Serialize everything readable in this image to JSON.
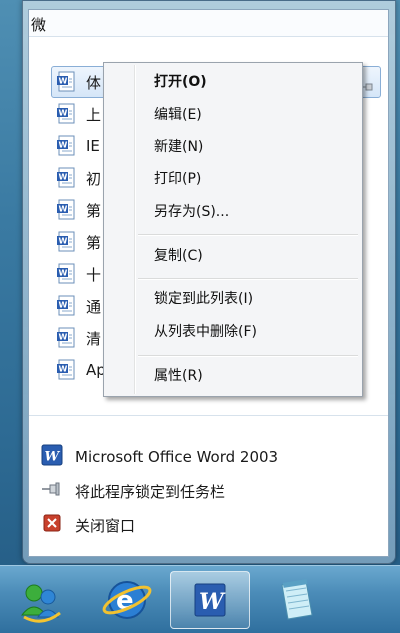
{
  "window": {
    "title_fragment": "微"
  },
  "recent_documents": [
    {
      "label": "体"
    },
    {
      "label": "上"
    },
    {
      "label": "IE"
    },
    {
      "label": "初"
    },
    {
      "label": "第"
    },
    {
      "label": "第"
    },
    {
      "label": "十"
    },
    {
      "label": "通"
    },
    {
      "label": "清"
    },
    {
      "label": "Ap"
    }
  ],
  "context_menu": {
    "open": "打开(O)",
    "edit": "编辑(E)",
    "new": "新建(N)",
    "print": "打印(P)",
    "save_as": "另存为(S)...",
    "copy": "复制(C)",
    "pin_to_list": "锁定到此列表(I)",
    "remove_from_list": "从列表中删除(F)",
    "properties": "属性(R)"
  },
  "tasks": {
    "app_name": "Microsoft Office Word 2003",
    "pin_to_taskbar": "将此程序锁定到任务栏",
    "close_window": "关闭窗口"
  },
  "taskbar": {
    "buttons": [
      "messenger-icon",
      "internet-explorer-icon",
      "word-icon",
      "notepad-icon"
    ],
    "active_index": 2
  },
  "colors": {
    "word_blue": "#2a5db0",
    "selection": "#d5e6f8",
    "close_red": "#c8402c"
  }
}
